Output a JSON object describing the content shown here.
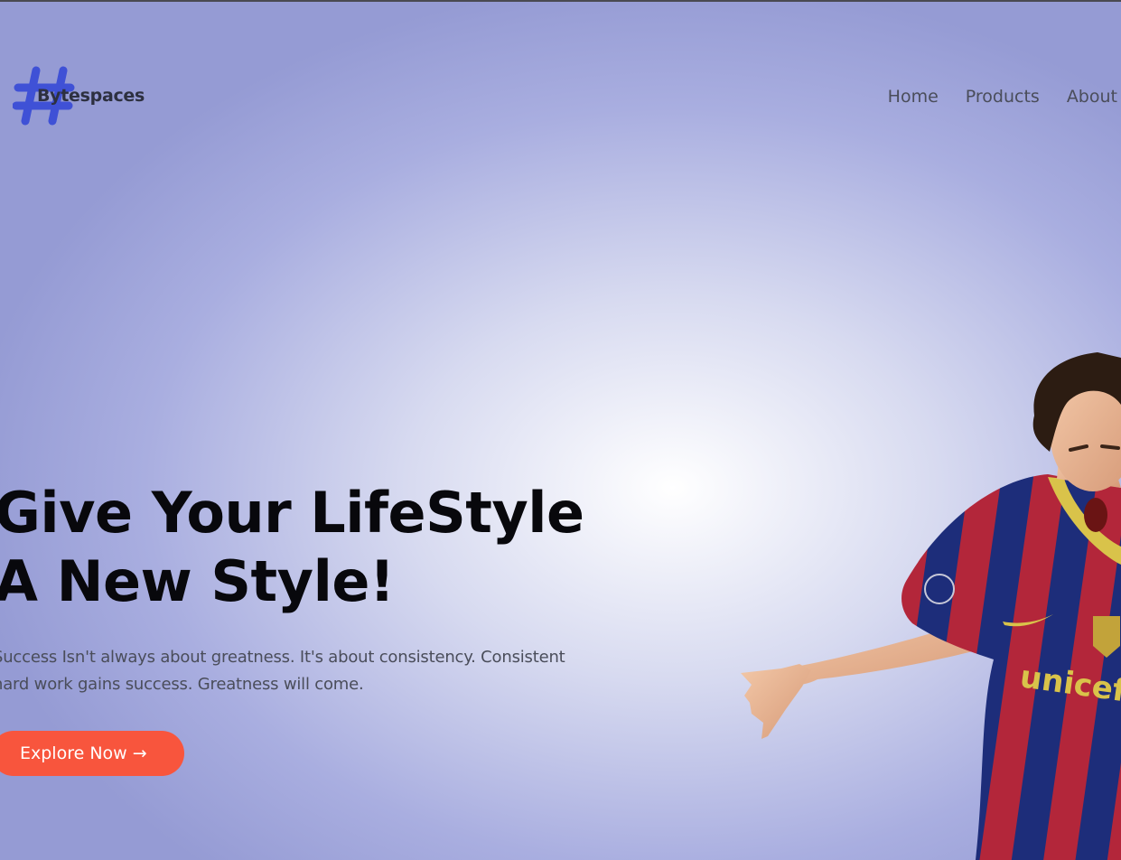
{
  "brand": {
    "name": "Bytespaces",
    "logo_icon": "hashtag-icon",
    "logo_color": "#3f51d6"
  },
  "nav": {
    "items": [
      {
        "label": "Home"
      },
      {
        "label": "Products"
      },
      {
        "label": "About"
      }
    ]
  },
  "hero": {
    "title_line1": "Give Your LifeStyle",
    "title_line2": "A New Style!",
    "description_line1": "Success Isn't always about greatness. It's about consistency. Consistent",
    "description_line2": "hard work gains success. Greatness will come.",
    "cta_label": "Explore Now",
    "cta_arrow": "→",
    "cta_color": "#f8553d",
    "image_label": "unicef"
  },
  "colors": {
    "background_center": "#ffffff",
    "background_edge": "#959bd4",
    "title": "#08080c",
    "body_text": "#4a4d5a"
  }
}
